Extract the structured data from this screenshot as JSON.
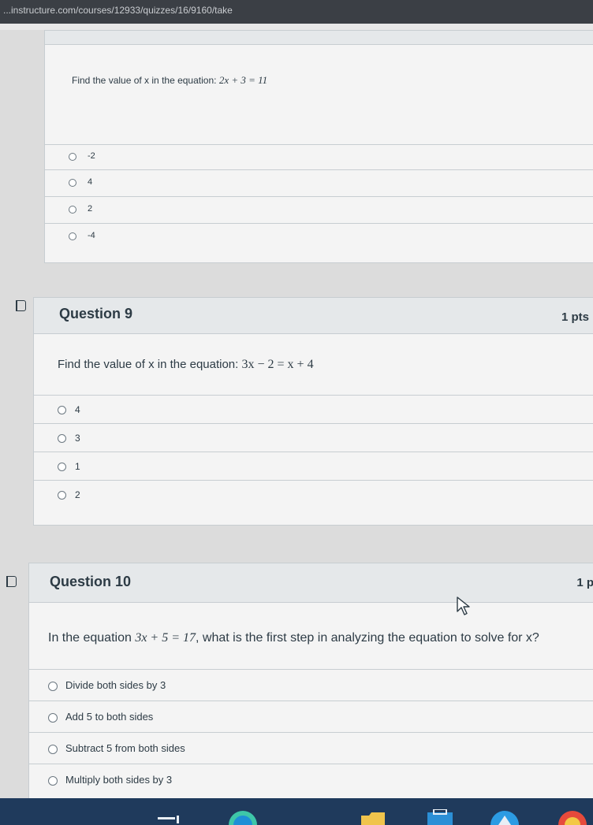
{
  "browser": {
    "url": "...instructure.com/courses/12933/quizzes/16/9160/take"
  },
  "question8": {
    "text_prefix": "Find the value of x in the equation:",
    "equation": "2x + 3 = 11",
    "answers": [
      "-2",
      "4",
      "2",
      "-4"
    ]
  },
  "question9": {
    "title": "Question 9",
    "points": "1 pts",
    "text_prefix": "Find the value of x in the equation:",
    "equation": "3x − 2 = x + 4",
    "answers": [
      "4",
      "3",
      "1",
      "2"
    ]
  },
  "question10": {
    "title": "Question 10",
    "points": "1 p",
    "text_prefix": "In the equation",
    "equation": "3x + 5 = 17",
    "text_suffix": ", what is the first step in analyzing the equation to solve for x?",
    "answers": [
      "Divide both sides by 3",
      "Add 5 to both sides",
      "Subtract 5 from both sides",
      "Multiply both sides by 3"
    ]
  },
  "colors": {
    "taskbar": "#1f3a5c",
    "card_bg": "#f4f4f4",
    "header_bg": "#e5e8ea",
    "text": "#2d3b45"
  },
  "icons": [
    "flag-icon",
    "cursor-icon",
    "radio-icon",
    "taskbar-icons"
  ]
}
